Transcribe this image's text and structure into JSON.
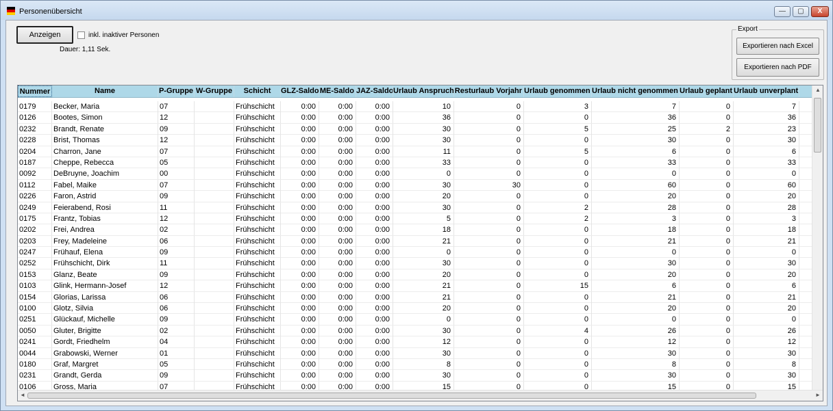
{
  "window": {
    "title": "Personenübersicht",
    "min_label": "—",
    "max_label": "▢",
    "close_label": "X"
  },
  "toolbar": {
    "show_button": "Anzeigen",
    "include_inactive_label": "inkl. inaktiver Personen",
    "include_inactive_checked": false,
    "duration": "Dauer: 1,11 Sek."
  },
  "export": {
    "legend": "Export",
    "excel_button": "Exportieren nach Excel",
    "pdf_button": "Exportieren nach PDF"
  },
  "colors": {
    "header_bg": "#aed8e8",
    "window_frame": "#cfe0f3"
  },
  "table": {
    "columns": [
      "Nummer",
      "Name",
      "P-Gruppe",
      "W-Gruppe",
      "Schicht",
      "GLZ-Saldo",
      "ME-Saldo",
      "JAZ-Saldo",
      "Urlaub Anspruch",
      "Resturlaub Vorjahr",
      "Urlaub genommen",
      "Urlaub nicht genommen",
      "Urlaub geplant",
      "Urlaub unverplant"
    ],
    "rows": [
      [
        "0179",
        "Becker, Maria",
        "07",
        "",
        "Frühschicht",
        "0:00",
        "0:00",
        "0:00",
        "10",
        "0",
        "3",
        "7",
        "0",
        "7"
      ],
      [
        "0126",
        "Bootes, Simon",
        "12",
        "",
        "Frühschicht",
        "0:00",
        "0:00",
        "0:00",
        "36",
        "0",
        "0",
        "36",
        "0",
        "36"
      ],
      [
        "0232",
        "Brandt, Renate",
        "09",
        "",
        "Frühschicht",
        "0:00",
        "0:00",
        "0:00",
        "30",
        "0",
        "5",
        "25",
        "2",
        "23"
      ],
      [
        "0228",
        "Brist, Thomas",
        "12",
        "",
        "Frühschicht",
        "0:00",
        "0:00",
        "0:00",
        "30",
        "0",
        "0",
        "30",
        "0",
        "30"
      ],
      [
        "0204",
        "Charron, Jane",
        "07",
        "",
        "Frühschicht",
        "0:00",
        "0:00",
        "0:00",
        "11",
        "0",
        "5",
        "6",
        "0",
        "6"
      ],
      [
        "0187",
        "Cheppe, Rebecca",
        "05",
        "",
        "Frühschicht",
        "0:00",
        "0:00",
        "0:00",
        "33",
        "0",
        "0",
        "33",
        "0",
        "33"
      ],
      [
        "0092",
        "DeBruyne, Joachim",
        "00",
        "",
        "Frühschicht",
        "0:00",
        "0:00",
        "0:00",
        "0",
        "0",
        "0",
        "0",
        "0",
        "0"
      ],
      [
        "0112",
        "Fabel, Maike",
        "07",
        "",
        "Frühschicht",
        "0:00",
        "0:00",
        "0:00",
        "30",
        "30",
        "0",
        "60",
        "0",
        "60"
      ],
      [
        "0226",
        "Faron, Astrid",
        "09",
        "",
        "Frühschicht",
        "0:00",
        "0:00",
        "0:00",
        "20",
        "0",
        "0",
        "20",
        "0",
        "20"
      ],
      [
        "0249",
        "Feierabend, Rosi",
        "11",
        "",
        "Frühschicht",
        "0:00",
        "0:00",
        "0:00",
        "30",
        "0",
        "2",
        "28",
        "0",
        "28"
      ],
      [
        "0175",
        "Frantz, Tobias",
        "12",
        "",
        "Frühschicht",
        "0:00",
        "0:00",
        "0:00",
        "5",
        "0",
        "2",
        "3",
        "0",
        "3"
      ],
      [
        "0202",
        "Frei, Andrea",
        "02",
        "",
        "Frühschicht",
        "0:00",
        "0:00",
        "0:00",
        "18",
        "0",
        "0",
        "18",
        "0",
        "18"
      ],
      [
        "0203",
        "Frey, Madeleine",
        "06",
        "",
        "Frühschicht",
        "0:00",
        "0:00",
        "0:00",
        "21",
        "0",
        "0",
        "21",
        "0",
        "21"
      ],
      [
        "0247",
        "Frühauf, Elena",
        "09",
        "",
        "Frühschicht",
        "0:00",
        "0:00",
        "0:00",
        "0",
        "0",
        "0",
        "0",
        "0",
        "0"
      ],
      [
        "0252",
        "Frühschicht, Dirk",
        "11",
        "",
        "Frühschicht",
        "0:00",
        "0:00",
        "0:00",
        "30",
        "0",
        "0",
        "30",
        "0",
        "30"
      ],
      [
        "0153",
        "Glanz, Beate",
        "09",
        "",
        "Frühschicht",
        "0:00",
        "0:00",
        "0:00",
        "20",
        "0",
        "0",
        "20",
        "0",
        "20"
      ],
      [
        "0103",
        "Glink, Hermann-Josef",
        "12",
        "",
        "Frühschicht",
        "0:00",
        "0:00",
        "0:00",
        "21",
        "0",
        "15",
        "6",
        "0",
        "6"
      ],
      [
        "0154",
        "Glorias, Larissa",
        "06",
        "",
        "Frühschicht",
        "0:00",
        "0:00",
        "0:00",
        "21",
        "0",
        "0",
        "21",
        "0",
        "21"
      ],
      [
        "0100",
        "Glotz, Silvia",
        "06",
        "",
        "Frühschicht",
        "0:00",
        "0:00",
        "0:00",
        "20",
        "0",
        "0",
        "20",
        "0",
        "20"
      ],
      [
        "0251",
        "Glückauf, Michelle",
        "09",
        "",
        "Frühschicht",
        "0:00",
        "0:00",
        "0:00",
        "0",
        "0",
        "0",
        "0",
        "0",
        "0"
      ],
      [
        "0050",
        "Gluter, Brigitte",
        "02",
        "",
        "Frühschicht",
        "0:00",
        "0:00",
        "0:00",
        "30",
        "0",
        "4",
        "26",
        "0",
        "26"
      ],
      [
        "0241",
        "Gordt, Friedhelm",
        "04",
        "",
        "Frühschicht",
        "0:00",
        "0:00",
        "0:00",
        "12",
        "0",
        "0",
        "12",
        "0",
        "12"
      ],
      [
        "0044",
        "Grabowski, Werner",
        "01",
        "",
        "Frühschicht",
        "0:00",
        "0:00",
        "0:00",
        "30",
        "0",
        "0",
        "30",
        "0",
        "30"
      ],
      [
        "0180",
        "Graf, Margret",
        "05",
        "",
        "Frühschicht",
        "0:00",
        "0:00",
        "0:00",
        "8",
        "0",
        "0",
        "8",
        "0",
        "8"
      ],
      [
        "0231",
        "Grandt, Gerda",
        "09",
        "",
        "Frühschicht",
        "0:00",
        "0:00",
        "0:00",
        "30",
        "0",
        "0",
        "30",
        "0",
        "30"
      ],
      [
        "0106",
        "Gross, Maria",
        "07",
        "",
        "Frühschicht",
        "0:00",
        "0:00",
        "0:00",
        "15",
        "0",
        "0",
        "15",
        "0",
        "15"
      ]
    ]
  }
}
